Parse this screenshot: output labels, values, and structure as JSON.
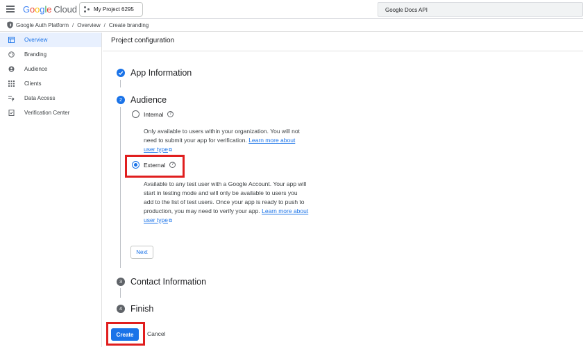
{
  "header": {
    "logo_text": "Google Cloud",
    "project_label": "My Project 6295",
    "search_value": "Google Docs API"
  },
  "breadcrumb": [
    "Google Auth Platform",
    "Overview",
    "Create branding"
  ],
  "sidebar": {
    "items": [
      {
        "label": "Overview",
        "icon": "grid-icon",
        "active": true
      },
      {
        "label": "Branding",
        "icon": "palette-icon",
        "active": false
      },
      {
        "label": "Audience",
        "icon": "person-icon",
        "active": false
      },
      {
        "label": "Clients",
        "icon": "apps-icon",
        "active": false
      },
      {
        "label": "Data Access",
        "icon": "key-list-icon",
        "active": false
      },
      {
        "label": "Verification Center",
        "icon": "verified-icon",
        "active": false
      }
    ]
  },
  "main": {
    "title": "Project configuration",
    "steps": [
      {
        "number": "✓",
        "label": "App Information",
        "state": "done"
      },
      {
        "number": "2",
        "label": "Audience",
        "state": "active"
      },
      {
        "number": "3",
        "label": "Contact Information",
        "state": "pending"
      },
      {
        "number": "4",
        "label": "Finish",
        "state": "pending"
      }
    ],
    "audience": {
      "internal": {
        "label": "Internal",
        "selected": false,
        "desc_lines": [
          "Only available to users within your organization. You will not",
          "need to submit your app for verification. "
        ],
        "link_text_1": "Learn more about",
        "link_text_2": "user type"
      },
      "external": {
        "label": "External",
        "selected": true,
        "desc_lines": [
          "Available to any test user with a Google Account. Your app will",
          "start in testing mode and will only be available to users you",
          "add to the list of test users. Once your app is ready to push to",
          "production, you may need to verify your app. "
        ],
        "link_text_1": "Learn more about",
        "link_text_2": "user type"
      },
      "next_label": "Next"
    },
    "create_label": "Create",
    "cancel_label": "Cancel"
  },
  "colors": {
    "accent": "#1a73e8",
    "highlight": "#e01e1e",
    "active_nav_bg": "#e8f0fe"
  }
}
